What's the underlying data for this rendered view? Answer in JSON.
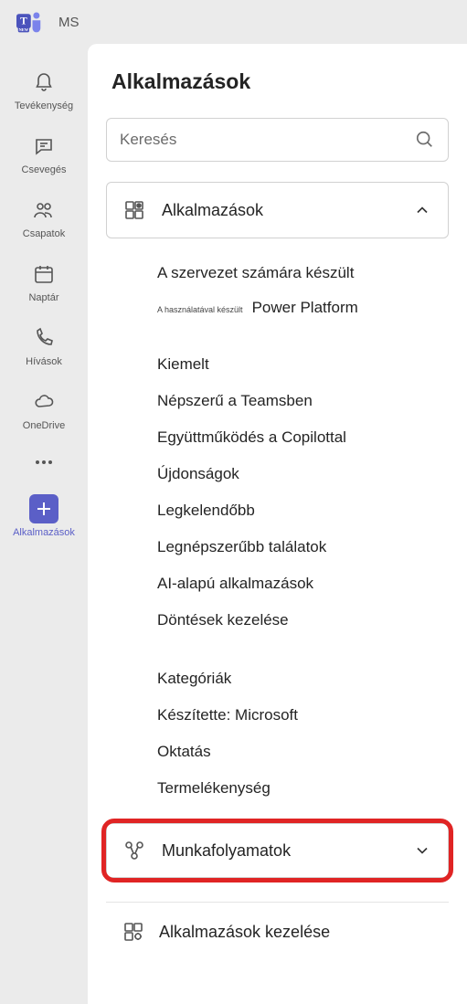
{
  "titlebar": {
    "user_initials": "MS"
  },
  "rail": {
    "items": [
      {
        "key": "activity",
        "label": "Tevékenység"
      },
      {
        "key": "chat",
        "label": "Csevegés"
      },
      {
        "key": "teams",
        "label": "Csapatok"
      },
      {
        "key": "calendar",
        "label": "Naptár"
      },
      {
        "key": "calls",
        "label": "Hívások"
      },
      {
        "key": "onedrive",
        "label": "OneDrive"
      }
    ],
    "apps_label": "Alkalmazások"
  },
  "apps": {
    "title": "Alkalmazások",
    "search_placeholder": "Keresés",
    "section_label": "Alkalmazások",
    "org_built": "A szervezet számára készült",
    "built_with_tiny": "A használatával készült",
    "power_platform": "Power Platform",
    "featured": "Kiemelt",
    "nav": [
      "Népszerű a Teamsben",
      "Együttműködés a Copilottal",
      "Újdonságok",
      "Legkelendőbb",
      "Legnépszerűbb találatok",
      "AI-alapú alkalmazások",
      "Döntések kezelése"
    ],
    "categories": "Kategóriák",
    "cat_nav": [
      "Készítette: Microsoft",
      "Oktatás",
      "Termelékenység"
    ],
    "workflows_label": "Munkafolyamatok",
    "manage_label": "Alkalmazások kezelése"
  }
}
